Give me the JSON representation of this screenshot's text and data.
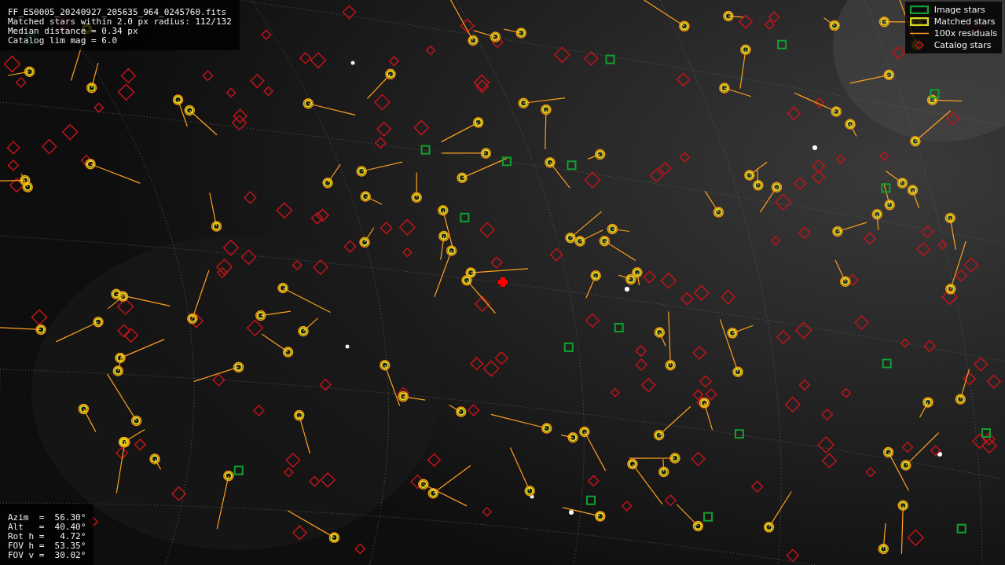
{
  "file_info": [
    "FF_ES0005_20240927_205635_964_0245760.fits",
    "Matched stars within 2.0 px radius: 112/132",
    "Median distance = 0.34 px",
    "Catalog lim mag = 6.0"
  ],
  "legend": [
    {
      "label": "Image stars"
    },
    {
      "kind": "matched",
      "label": "Matched stars"
    },
    {
      "kind": "residual",
      "label": "100x residuals"
    },
    {
      "kind": "catalog",
      "label": "Catalog stars"
    }
  ],
  "pointing": [
    "Azim  =  56.30°",
    "Alt   =  40.40°",
    "Rot h =   4.72°",
    "FOV h =  53.35°",
    "FOV v =  30.02°"
  ]
}
